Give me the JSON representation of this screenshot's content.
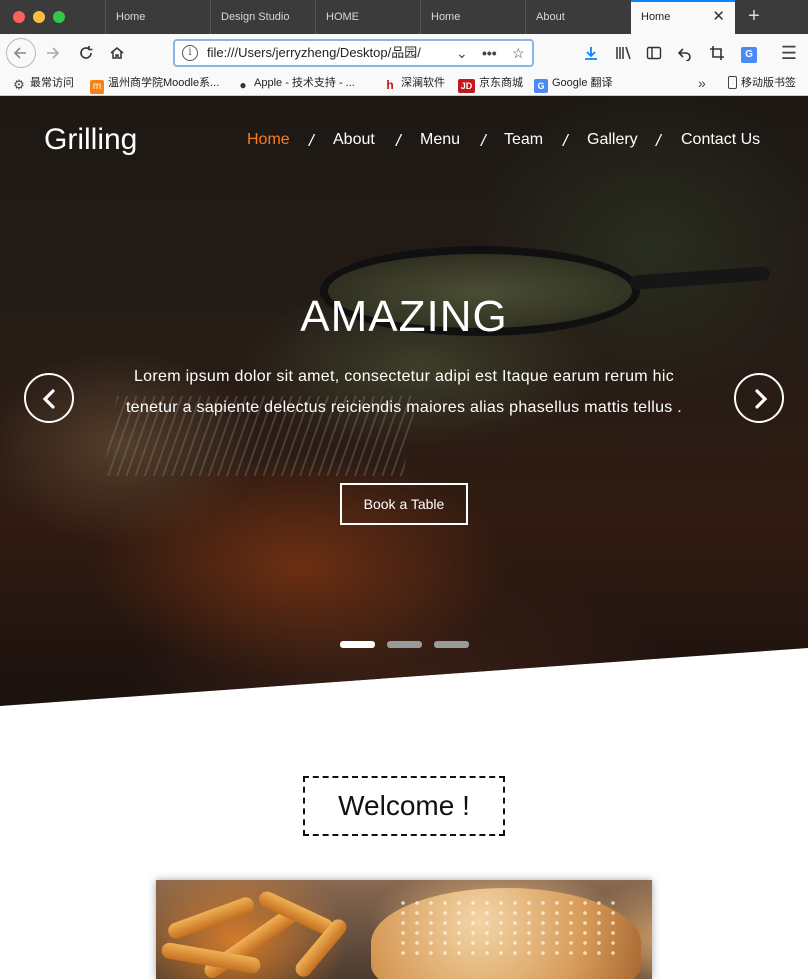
{
  "browser": {
    "tabs": [
      {
        "label": "Home"
      },
      {
        "label": "Design Studio"
      },
      {
        "label": "HOME"
      },
      {
        "label": "Home"
      },
      {
        "label": "About"
      },
      {
        "label": "Home",
        "active": true
      }
    ],
    "url": "file:///Users/jerryzheng/Desktop/品园/",
    "bookmarks": [
      {
        "label": "最常访问",
        "icon": "gear-icon"
      },
      {
        "label": "温州商学院Moodle系...",
        "icon": "moodle-icon"
      },
      {
        "label": "Apple - 技术支持 - ...",
        "icon": "apple-icon"
      },
      {
        "label": "深澜软件",
        "icon": "srun-icon"
      },
      {
        "label": "京东商城",
        "icon": "jd-icon"
      },
      {
        "label": "Google 翻译",
        "icon": "google-translate-icon"
      }
    ],
    "mobile_bookmarks": "移动版书签"
  },
  "site": {
    "brand": "Grilling",
    "nav": [
      {
        "label": "Home",
        "active": true
      },
      {
        "label": "About"
      },
      {
        "label": "Menu"
      },
      {
        "label": "Team"
      },
      {
        "label": "Gallery"
      },
      {
        "label": "Contact Us"
      }
    ],
    "nav_separator": "/",
    "hero": {
      "title": "AMAZING",
      "text": "Lorem ipsum dolor sit amet, consectetur adipi est Itaque earum rerum hic tenetur a sapiente delectus reiciendis maiores alias phasellus mattis tellus .",
      "button": "Book a Table",
      "slides": 3,
      "active_slide": 1
    },
    "welcome": "Welcome !"
  },
  "colors": {
    "accent": "#ff7a1a",
    "tab_highlight": "#0a84ff"
  }
}
